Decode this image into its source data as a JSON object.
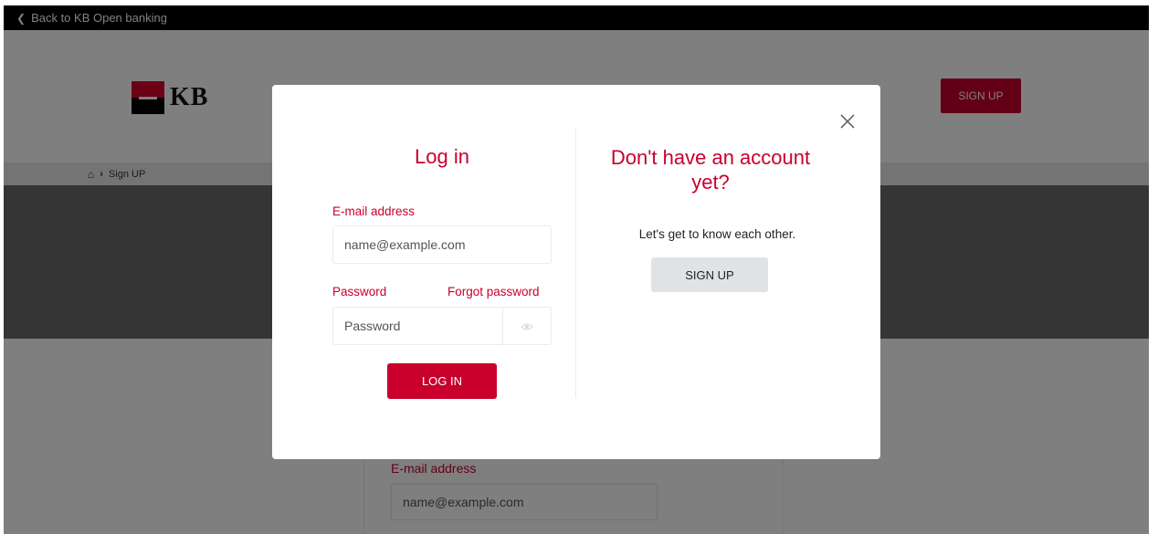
{
  "topbar": {
    "back_label": "Back to KB Open banking"
  },
  "header": {
    "logo_text": "KB",
    "signup_label": "SIGN UP"
  },
  "breadcrumb": {
    "current": "Sign UP"
  },
  "background_form": {
    "email_label": "E-mail address",
    "email_placeholder": "name@example.com"
  },
  "modal": {
    "login": {
      "title": "Log in",
      "email_label": "E-mail address",
      "email_placeholder": "name@example.com",
      "password_label": "Password",
      "forgot_label": "Forgot password",
      "password_placeholder": "Password",
      "submit_label": "LOG IN"
    },
    "signup": {
      "title": "Don't have an account yet?",
      "text": "Let's get to know each other.",
      "button_label": "SIGN UP"
    }
  },
  "colors": {
    "brand": "#c9002c",
    "overlay": "rgba(0,0,0,0.5)",
    "secondary_button": "#e0e2e5"
  }
}
